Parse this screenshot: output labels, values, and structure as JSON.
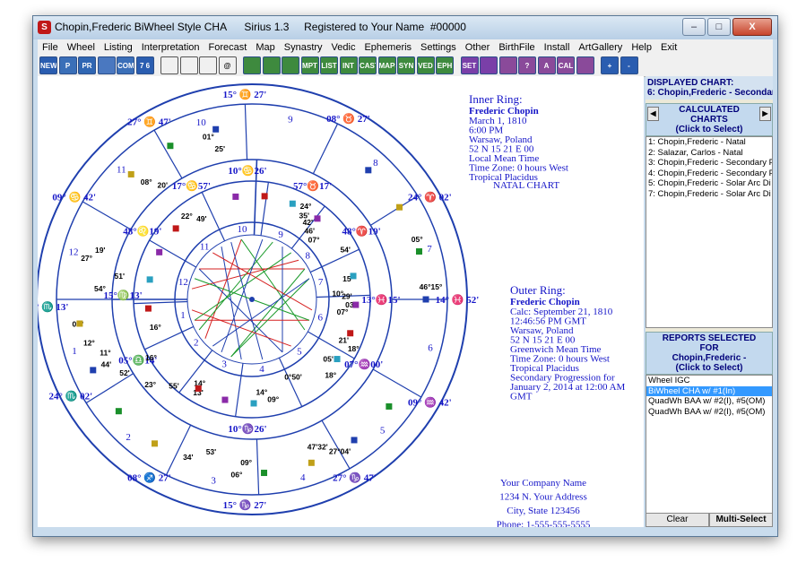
{
  "window": {
    "title": "Chopin,Frederic BiWheel Style CHA      Sirius 1.3     Registered to Your Name  #00000",
    "controls": [
      "–",
      "□",
      "X"
    ]
  },
  "menu": [
    "File",
    "Wheel",
    "Listing",
    "Interpretation",
    "Forecast",
    "Map",
    "Synastry",
    "Vedic",
    "Ephemeris",
    "Settings",
    "Other",
    "BirthFile",
    "Install",
    "ArtGallery",
    "Help",
    "Exit"
  ],
  "toolbar": {
    "labels": [
      "NEW",
      "P",
      "PR",
      "",
      "COMP",
      "7 6",
      "",
      "",
      "",
      "@",
      "",
      "",
      "",
      "MPT",
      "LIST",
      "INT",
      "CAST",
      "MAPS",
      "SYN",
      "VED",
      "EPH",
      "SET",
      "",
      "",
      "?",
      "A",
      "CAL",
      "",
      "+",
      "-"
    ]
  },
  "inner_ring": {
    "heading": "Inner Ring:",
    "name": "Frederic Chopin",
    "lines": [
      "March 1, 1810",
      "6:00 PM",
      "Warsaw, Poland",
      "52 N 15    21 E 00",
      "Local Mean Time",
      "Time Zone: 0 hours West",
      "Tropical Placidus"
    ],
    "type": "NATAL CHART"
  },
  "outer_ring": {
    "heading": "Outer Ring:",
    "name": "Frederic Chopin",
    "lines": [
      "Calc: September 21, 1810",
      "12:46:56 PM GMT",
      "Warsaw, Poland",
      "52 N 15    21 E 00",
      "Greenwich Mean Time",
      "Time Zone: 0 hours West",
      "Tropical Placidus",
      "Secondary Progression  for",
      "January 2, 2014 at 12:00 AM",
      "GMT"
    ]
  },
  "company": [
    "Your Company Name",
    "1234 N. Your Address",
    "City, State 123456",
    "Phone: 1-555-555-5555",
    "name@YourSite.com"
  ],
  "wheel": {
    "outer_house_numbers": [
      "1",
      "2",
      "3",
      "4",
      "5",
      "6",
      "7",
      "8",
      "9",
      "10",
      "11",
      "12"
    ],
    "inner_house_numbers": [
      "1",
      "2",
      "3",
      "4",
      "5",
      "6",
      "7",
      "8",
      "9",
      "10",
      "11",
      "12"
    ],
    "outer_cusps": [
      {
        "deg": "15°",
        "sign": "♏",
        "min": "13'"
      },
      {
        "deg": "24°",
        "sign": "♏",
        "min": "02'"
      },
      {
        "deg": "08°",
        "sign": "♐",
        "min": "27'"
      },
      {
        "deg": "15°",
        "sign": "♑",
        "min": "27'"
      },
      {
        "deg": "27°",
        "sign": "♑",
        "min": "47'"
      },
      {
        "deg": "09°",
        "sign": "♒",
        "min": "42'"
      },
      {
        "deg": "14°",
        "sign": "♓",
        "min": "52'"
      },
      {
        "deg": "24°",
        "sign": "♈",
        "min": "02'"
      },
      {
        "deg": "08°",
        "sign": "♉",
        "min": "27'"
      },
      {
        "deg": "15°",
        "sign": "♊",
        "min": "27'"
      },
      {
        "deg": "27°",
        "sign": "♊",
        "min": "47'"
      },
      {
        "deg": "09°",
        "sign": "♋",
        "min": "42'"
      }
    ],
    "inner_cusps": [
      {
        "deg": "10°",
        "sign": "♋",
        "min": "26'"
      },
      {
        "deg": "17°",
        "sign": "♋",
        "min": "57'"
      },
      {
        "deg": "48°",
        "sign": "♌",
        "min": "19'"
      },
      {
        "deg": "15°",
        "sign": "♍",
        "min": "13'"
      },
      {
        "deg": "05°",
        "sign": "♎",
        "min": "14'"
      },
      {
        "deg": "10°",
        "sign": "♑",
        "min": "26'"
      },
      {
        "deg": "07°",
        "sign": "♒",
        "min": "00'"
      },
      {
        "deg": "13°",
        "sign": "♓",
        "min": "15'"
      },
      {
        "deg": "48°",
        "sign": "♈",
        "min": "19'"
      },
      {
        "deg": "57°",
        "sign": "♉",
        "min": "17'"
      }
    ],
    "planet_labels": [
      "01°",
      "25'",
      "08°",
      "20'",
      "27°",
      "19'",
      "22°",
      "49'",
      "16°",
      "24°",
      "35'",
      "42'",
      "46'",
      "07°",
      "54'",
      "05°",
      "15°",
      "46°15°",
      "29'",
      "03'",
      "10°",
      "07°",
      "21'",
      "18°",
      "05'",
      "18°",
      "0°50'",
      "09°",
      "14°",
      "13'",
      "14°",
      "55'",
      "23°",
      "52'",
      "44'",
      "11°",
      "12°",
      "34'",
      "53'",
      "06°",
      "09°",
      "47'32'",
      "27°04'",
      "51'",
      "54°",
      "05°",
      "16°"
    ]
  },
  "sidebar": {
    "displayed_label": "DISPLAYED CHART:",
    "displayed_value": "6: Chopin,Frederic - Secondar",
    "calc_title": "CALCULATED CHARTS",
    "calc_subtitle": "(Click to Select)",
    "charts": [
      "1: Chopin,Frederic - Natal",
      "2: Salazar, Carlos - Natal",
      "3: Chopin,Frederic - Secondary P",
      "4: Chopin,Frederic - Secondary P",
      "5: Chopin,Frederic - Solar Arc Di",
      "7: Chopin,Frederic - Solar Arc Di"
    ],
    "reports_title": "REPORTS SELECTED FOR",
    "reports_name": "Chopin,Frederic -",
    "reports_subtitle": "(Click to Select)",
    "reports": [
      "Wheel IGC",
      "BiWheel CHA w/ #1(In)",
      "QuadWh BAA w/ #2(I), #5(OM)",
      "QuadWh BAA w/ #2(I), #5(OM)"
    ],
    "selected_report_index": 1,
    "clear_label": "Clear",
    "multi_label": "Multi-Select"
  },
  "colors": {
    "ring_blue": "#1f3fae",
    "text_blue": "#1515c8",
    "selection": "#3399ff"
  }
}
